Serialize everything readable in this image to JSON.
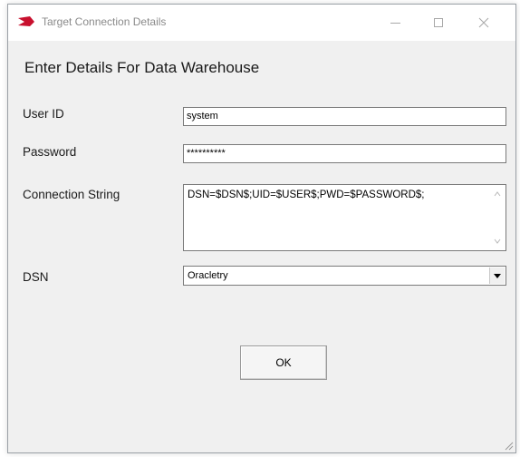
{
  "window": {
    "title": "Target Connection Details"
  },
  "form": {
    "heading": "Enter Details For Data Warehouse",
    "user_id_label": "User ID",
    "user_id_value": "system",
    "password_label": "Password",
    "password_value": "**********",
    "connection_string_label": "Connection String",
    "connection_string_value": "DSN=$DSN$;UID=$USER$;PWD=$PASSWORD$;",
    "dsn_label": "DSN",
    "dsn_value": "Oracletry"
  },
  "buttons": {
    "ok_label": "OK"
  },
  "icons": {
    "app": "red-arrow-logo-icon",
    "minimize": "minimize-icon",
    "maximize": "maximize-icon",
    "close": "close-icon",
    "dropdown": "chevron-down-icon"
  },
  "colors": {
    "accent": "#c8102e",
    "dialog_bg": "#f0f0f0"
  }
}
